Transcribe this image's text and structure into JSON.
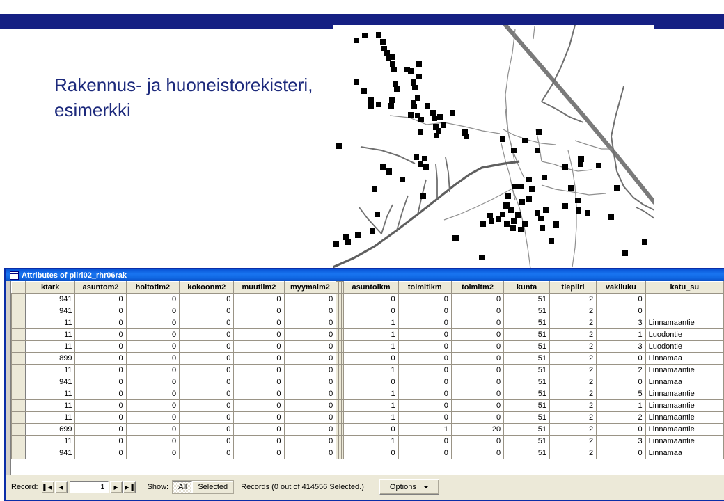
{
  "slide": {
    "title": "Rakennus- ja huoneistorekisteri,\nesimerkki",
    "band_color": "#152083",
    "title_color": "#1d2a7c"
  },
  "map": {
    "name": "building-register-map",
    "description": "Map with black square building points, thick grey highway and thin grey roads"
  },
  "window": {
    "title": "Attributes of piiri02_rhr06rak",
    "icon": "table-grid-icon"
  },
  "table": {
    "columns": [
      "ktark",
      "asuntom2",
      "hoitotim2",
      "kokoonm2",
      "muutilm2",
      "myymalm2",
      "asuntolkm",
      "toimitlkm",
      "toimitm2",
      "kunta",
      "tiepiiri",
      "vakiluku",
      "katu_su"
    ],
    "rows": [
      [
        "941",
        "0",
        "0",
        "0",
        "0",
        "0",
        "0",
        "0",
        "0",
        "51",
        "2",
        "0",
        ""
      ],
      [
        "941",
        "0",
        "0",
        "0",
        "0",
        "0",
        "0",
        "0",
        "0",
        "51",
        "2",
        "0",
        ""
      ],
      [
        "11",
        "0",
        "0",
        "0",
        "0",
        "0",
        "1",
        "0",
        "0",
        "51",
        "2",
        "3",
        "Linnamaantie"
      ],
      [
        "11",
        "0",
        "0",
        "0",
        "0",
        "0",
        "1",
        "0",
        "0",
        "51",
        "2",
        "1",
        "Luodontie"
      ],
      [
        "11",
        "0",
        "0",
        "0",
        "0",
        "0",
        "1",
        "0",
        "0",
        "51",
        "2",
        "3",
        "Luodontie"
      ],
      [
        "899",
        "0",
        "0",
        "0",
        "0",
        "0",
        "0",
        "0",
        "0",
        "51",
        "2",
        "0",
        "Linnamaa"
      ],
      [
        "11",
        "0",
        "0",
        "0",
        "0",
        "0",
        "1",
        "0",
        "0",
        "51",
        "2",
        "2",
        "Linnamaantie"
      ],
      [
        "941",
        "0",
        "0",
        "0",
        "0",
        "0",
        "0",
        "0",
        "0",
        "51",
        "2",
        "0",
        "Linnamaa"
      ],
      [
        "11",
        "0",
        "0",
        "0",
        "0",
        "0",
        "1",
        "0",
        "0",
        "51",
        "2",
        "5",
        "Linnamaantie"
      ],
      [
        "11",
        "0",
        "0",
        "0",
        "0",
        "0",
        "1",
        "0",
        "0",
        "51",
        "2",
        "1",
        "Linnamaantie"
      ],
      [
        "11",
        "0",
        "0",
        "0",
        "0",
        "0",
        "1",
        "0",
        "0",
        "51",
        "2",
        "2",
        "Linnamaantie"
      ],
      [
        "699",
        "0",
        "0",
        "0",
        "0",
        "0",
        "0",
        "1",
        "20",
        "51",
        "2",
        "0",
        "Linnamaantie"
      ],
      [
        "11",
        "0",
        "0",
        "0",
        "0",
        "0",
        "1",
        "0",
        "0",
        "51",
        "2",
        "3",
        "Linnamaantie"
      ],
      [
        "941",
        "0",
        "0",
        "0",
        "0",
        "0",
        "0",
        "0",
        "0",
        "51",
        "2",
        "0",
        "Linnamaa"
      ]
    ]
  },
  "scrollbar": {
    "left_arrow": "❮",
    "thumb_grip": "‖"
  },
  "statusbar": {
    "record_label": "Record:",
    "first_icon": "▌◀",
    "prev_icon": "◀",
    "record_value": "1",
    "next_icon": "▶",
    "last_icon": "▶▐",
    "show_label": "Show:",
    "show_all": "All",
    "show_selected": "Selected",
    "records_text": "Records  (0 out of 414556 Selected.)",
    "options_label": "Options"
  }
}
